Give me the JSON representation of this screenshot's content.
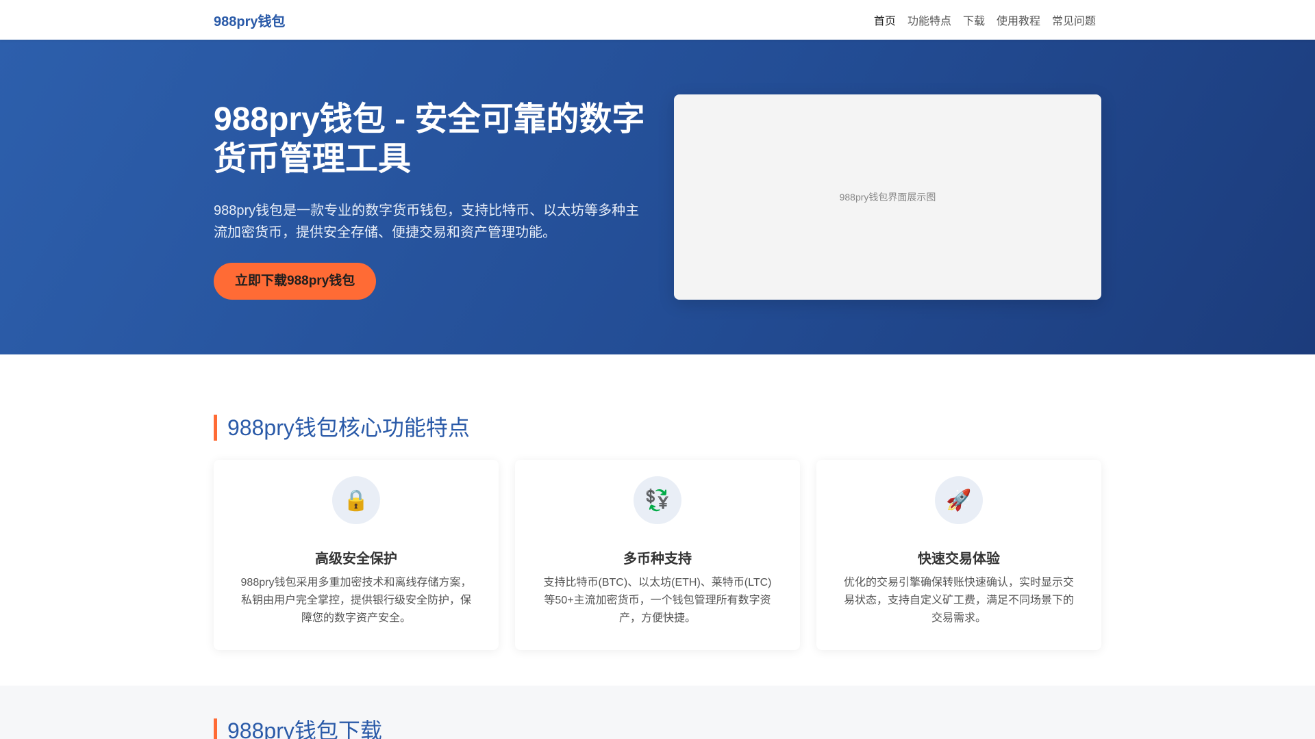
{
  "header": {
    "logo": "988pry钱包",
    "nav": [
      {
        "label": "首页",
        "active": true
      },
      {
        "label": "功能特点",
        "active": false
      },
      {
        "label": "下载",
        "active": false
      },
      {
        "label": "使用教程",
        "active": false
      },
      {
        "label": "常见问题",
        "active": false
      }
    ]
  },
  "hero": {
    "title": "988pry钱包 - 安全可靠的数字货币管理工具",
    "description": "988pry钱包是一款专业的数字货币钱包，支持比特币、以太坊等多种主流加密货币，提供安全存储、便捷交易和资产管理功能。",
    "cta_label": "立即下载988pry钱包",
    "image_alt": "988pry钱包界面展示图"
  },
  "features": {
    "title": "988pry钱包核心功能特点",
    "cards": [
      {
        "icon": "lock-icon",
        "glyph": "🔒",
        "title": "高级安全保护",
        "text": "988pry钱包采用多重加密技术和离线存储方案，私钥由用户完全掌控，提供银行级安全防护，保障您的数字资产安全。"
      },
      {
        "icon": "currency-exchange-icon",
        "glyph": "💱",
        "title": "多币种支持",
        "text": "支持比特币(BTC)、以太坊(ETH)、莱特币(LTC)等50+主流加密货币，一个钱包管理所有数字资产，方便快捷。"
      },
      {
        "icon": "rocket-icon",
        "glyph": "🚀",
        "title": "快速交易体验",
        "text": "优化的交易引擎确保转账快速确认，实时显示交易状态，支持自定义矿工费，满足不同场景下的交易需求。"
      }
    ]
  },
  "download": {
    "title": "988pry钱包下载"
  },
  "colors": {
    "brand": "#2a5aa8",
    "accent": "#ff6b35",
    "hero_bg": "#234d95"
  }
}
